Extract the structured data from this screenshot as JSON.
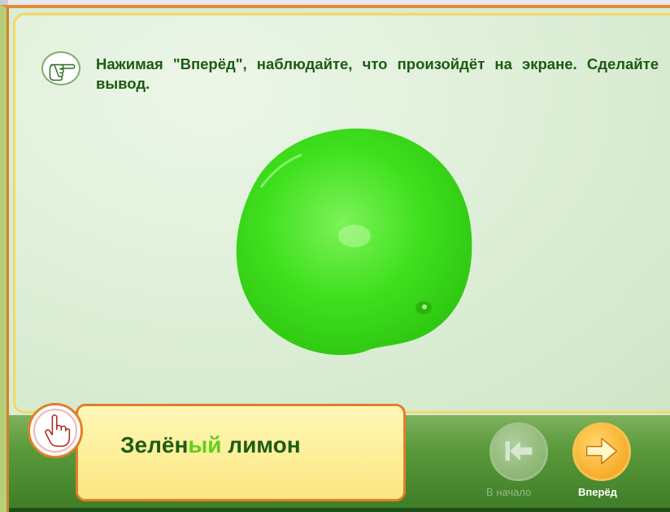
{
  "instruction": {
    "text": "Нажимая \"Вперёд\", наблюдайте, что произойдёт на экране. Сделайте вывод.",
    "icon": "pointing-hand-icon"
  },
  "image": {
    "subject": "green lemon"
  },
  "caption": {
    "part1": "Зелён",
    "highlight": "ый",
    "part2": " лимон",
    "icon": "raised-finger-hand-icon",
    "highlight_color": "#5fd11a",
    "text_color": "#1e5d12"
  },
  "navigation": {
    "start_label": "В начало",
    "next_label": "Вперёд",
    "start_enabled": false
  },
  "colors": {
    "frame_orange": "#e07f2a",
    "panel_border": "#f2d86a",
    "bottom_bar": "#5b9a3b",
    "next_button": "#f49a12"
  }
}
